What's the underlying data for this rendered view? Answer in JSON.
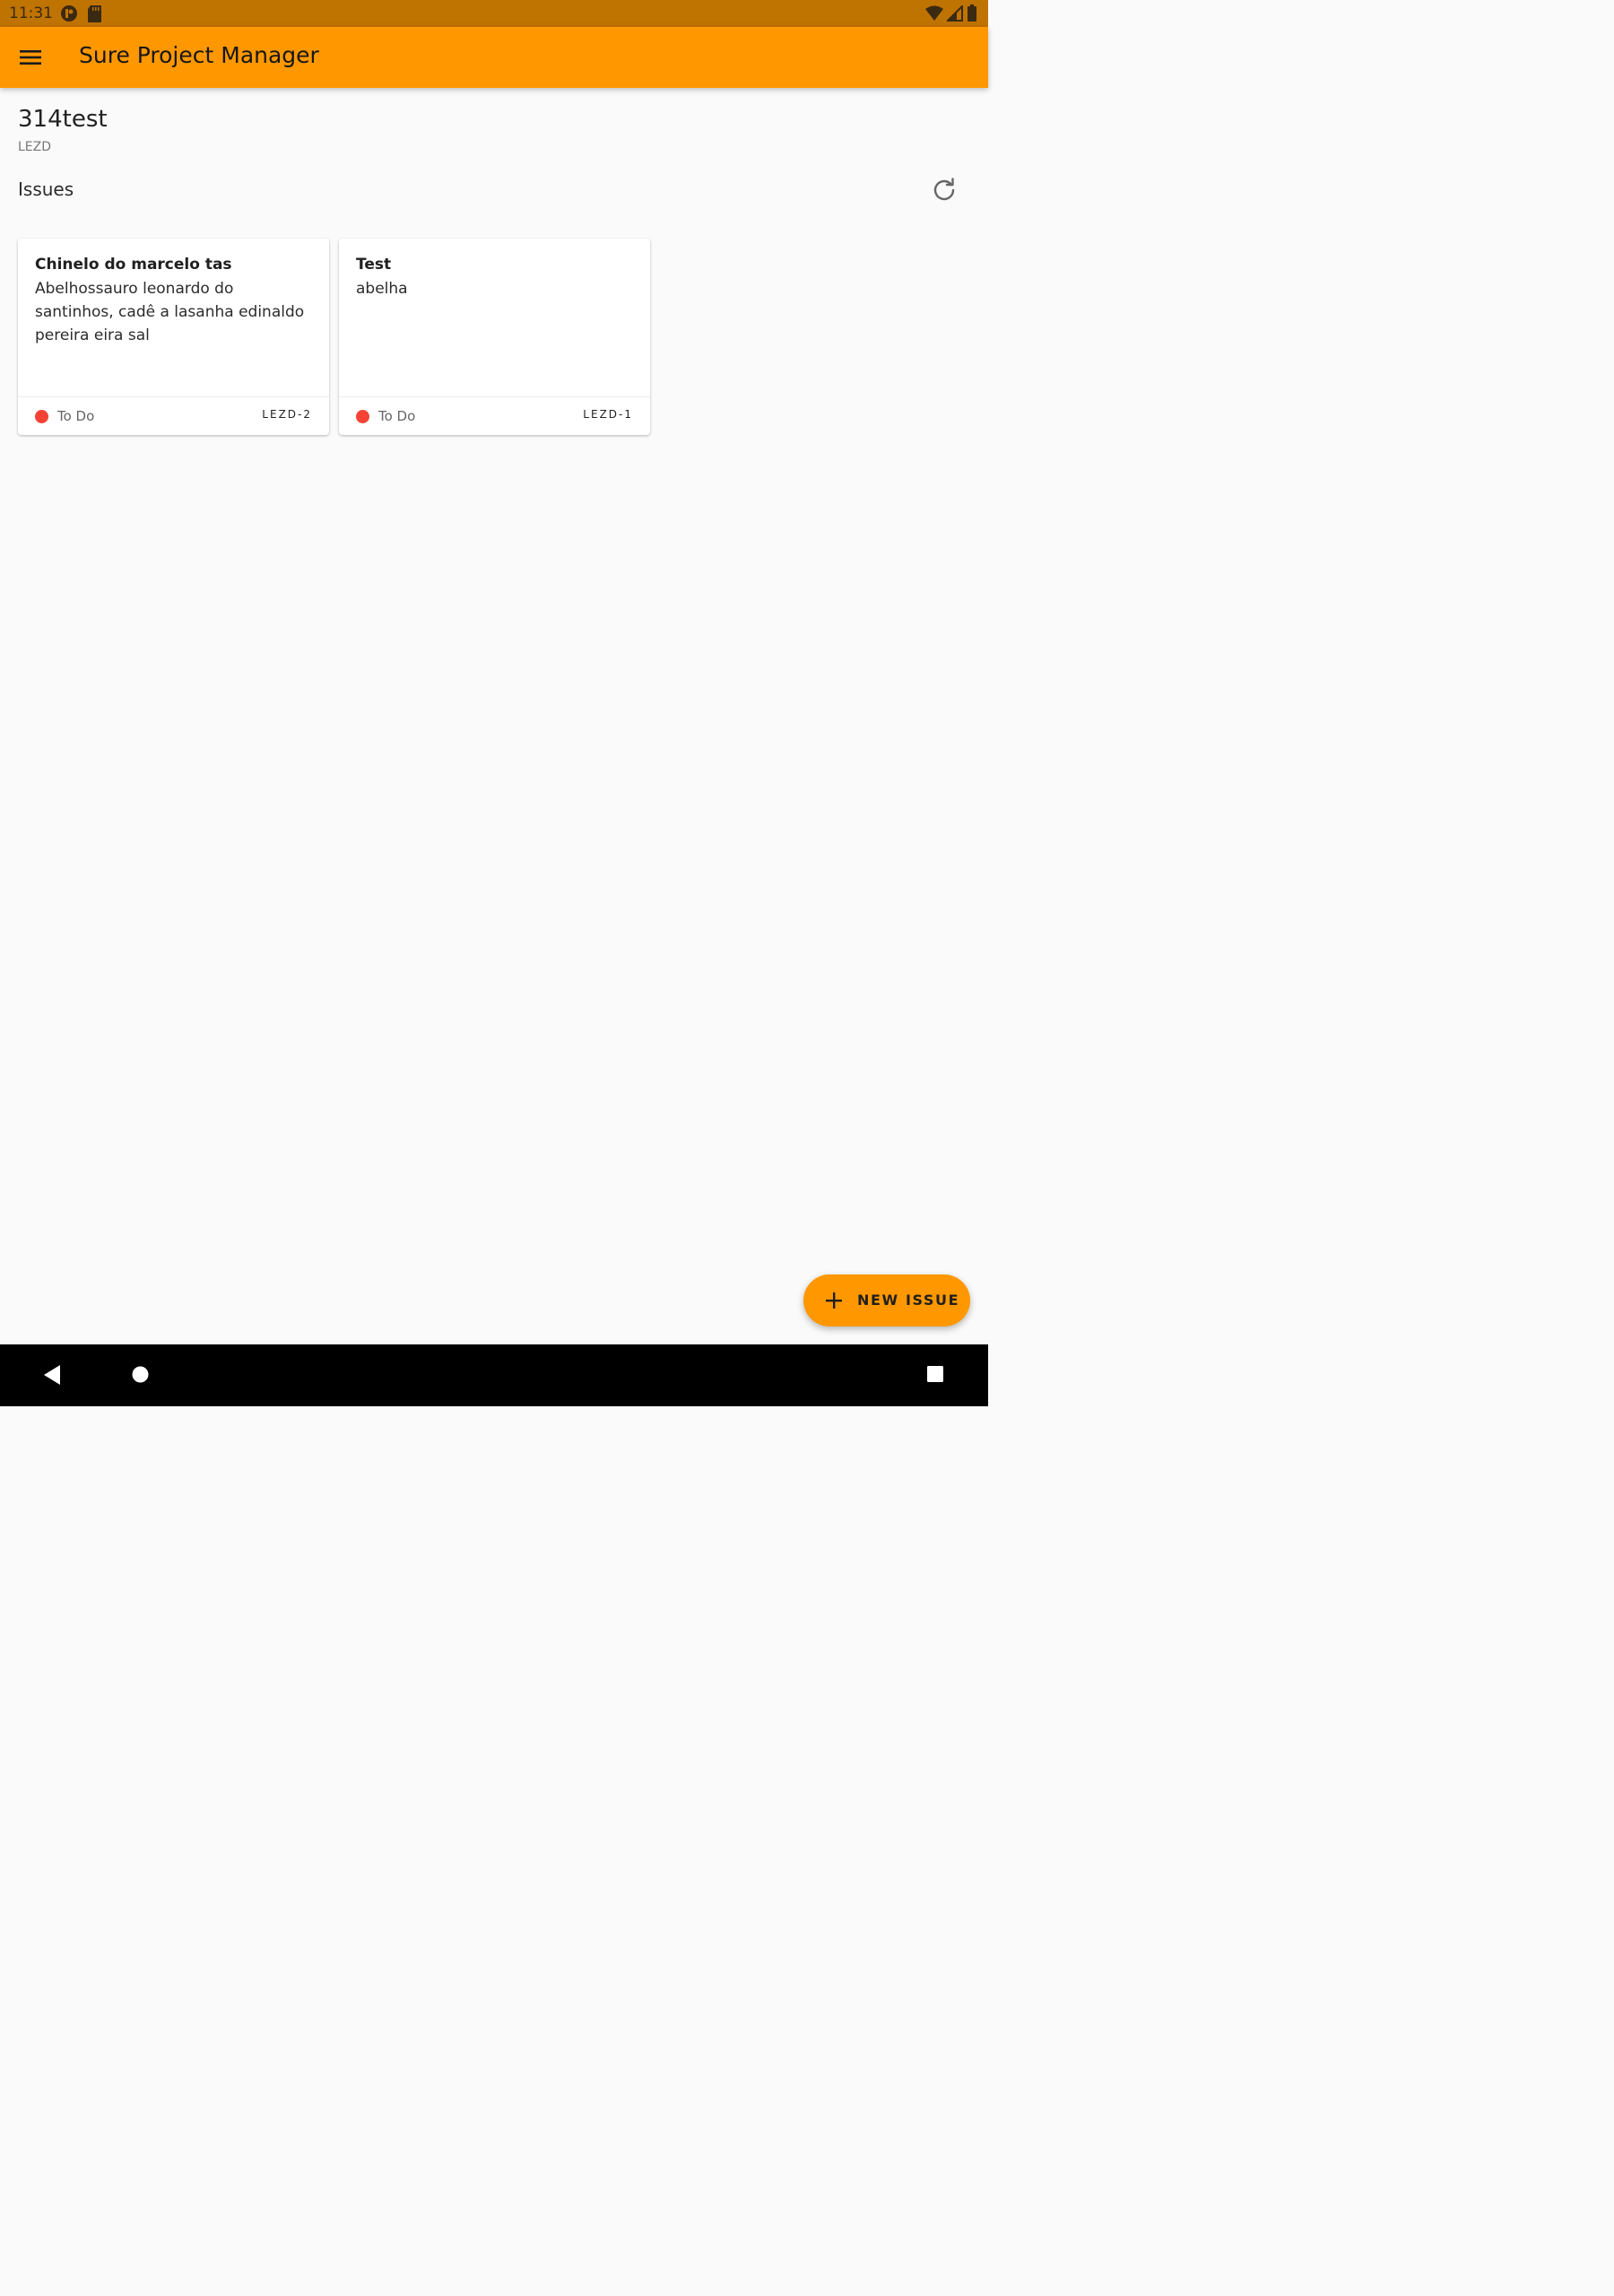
{
  "status_bar": {
    "time": "11:31",
    "icons": [
      "media-icon",
      "sd-card-icon",
      "wifi-icon",
      "signal-icon",
      "battery-icon"
    ]
  },
  "app_bar": {
    "title": "Sure Project Manager",
    "menu_icon": "menu-icon",
    "color": "#ff9800"
  },
  "project": {
    "title": "314test",
    "key": "LEZD"
  },
  "issues_section": {
    "heading": "Issues",
    "refresh_icon": "refresh-icon"
  },
  "issues": [
    {
      "title": "Chinelo do marcelo tas",
      "description": "Abelhossauro leonardo do santinhos, cadê a lasanha edinaldo pereira eira sal",
      "status": "To Do",
      "status_color": "#f44336",
      "key": "LEZD-2"
    },
    {
      "title": "Test",
      "description": "abelha",
      "status": "To Do",
      "status_color": "#f44336",
      "key": "LEZD-1"
    }
  ],
  "fab": {
    "label": "NEW ISSUE",
    "icon": "plus-icon"
  },
  "nav_bar": {
    "icons": [
      "back-icon",
      "home-icon",
      "recents-icon"
    ]
  }
}
